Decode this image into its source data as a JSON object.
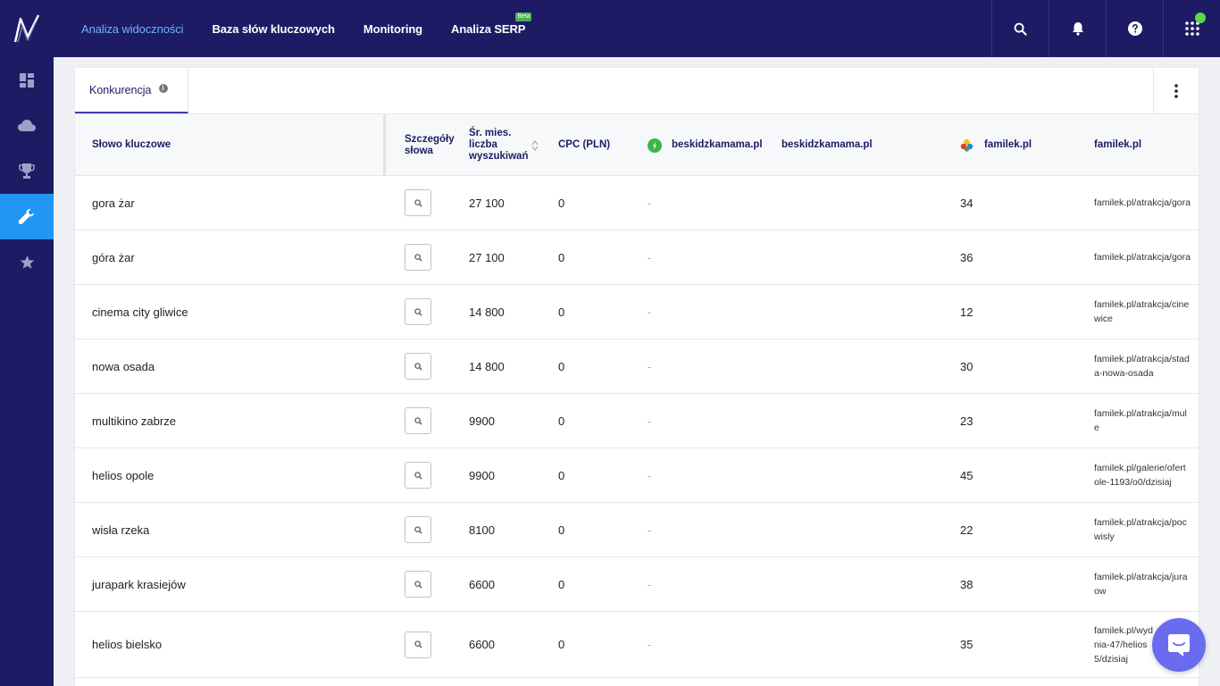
{
  "nav": {
    "items": [
      {
        "label": "Analiza widoczności",
        "active": true
      },
      {
        "label": "Baza słów kluczowych",
        "active": false
      },
      {
        "label": "Monitoring",
        "active": false
      },
      {
        "label": "Analiza SERP",
        "active": false
      }
    ],
    "beta_badge": "Beta"
  },
  "tabs": {
    "active_label": "Konkurencja",
    "info_glyph": "i"
  },
  "table": {
    "headers": {
      "keyword": "Słowo kluczowe",
      "details_1": "Szczegóły",
      "details_2": "słowa",
      "volume_1": "Śr. mies.",
      "volume_2": "liczba",
      "volume_3": "wyszukiwań",
      "cpc": "CPC (PLN)",
      "competitor_1_pos": "beskidzkamama.pl",
      "competitor_1_url": "beskidzkamama.pl",
      "competitor_2_pos": "familek.pl",
      "competitor_2_url": "familek.pl"
    },
    "rows": [
      {
        "keyword": "gora żar",
        "volume": "27 100",
        "cpc": "0",
        "beskidzkamama": "-",
        "familek_pos": "34",
        "familek_url_1": "familek.pl/atrakcja/gora",
        "familek_url_2": ""
      },
      {
        "keyword": "góra żar",
        "volume": "27 100",
        "cpc": "0",
        "beskidzkamama": "-",
        "familek_pos": "36",
        "familek_url_1": "familek.pl/atrakcja/gora",
        "familek_url_2": ""
      },
      {
        "keyword": "cinema city gliwice",
        "volume": "14 800",
        "cpc": "0",
        "beskidzkamama": "-",
        "familek_pos": "12",
        "familek_url_1": "familek.pl/atrakcja/cine",
        "familek_url_2": "wice"
      },
      {
        "keyword": "nowa osada",
        "volume": "14 800",
        "cpc": "0",
        "beskidzkamama": "-",
        "familek_pos": "30",
        "familek_url_1": "familek.pl/atrakcja/stad",
        "familek_url_2": "a-nowa-osada"
      },
      {
        "keyword": "multikino zabrze",
        "volume": "9900",
        "cpc": "0",
        "beskidzkamama": "-",
        "familek_pos": "23",
        "familek_url_1": "familek.pl/atrakcja/mul",
        "familek_url_2": "e"
      },
      {
        "keyword": "helios opole",
        "volume": "9900",
        "cpc": "0",
        "beskidzkamama": "-",
        "familek_pos": "45",
        "familek_url_1": "familek.pl/galerie/ofert",
        "familek_url_2": "ole-1193/o0/dzisiaj"
      },
      {
        "keyword": "wisła rzeka",
        "volume": "8100",
        "cpc": "0",
        "beskidzkamama": "-",
        "familek_pos": "22",
        "familek_url_1": "familek.pl/atrakcja/poc",
        "familek_url_2": "wisly"
      },
      {
        "keyword": "jurapark krasiejów",
        "volume": "6600",
        "cpc": "0",
        "beskidzkamama": "-",
        "familek_pos": "38",
        "familek_url_1": "familek.pl/atrakcja/jura",
        "familek_url_2": "ow"
      },
      {
        "keyword": "helios bielsko",
        "volume": "6600",
        "cpc": "0",
        "beskidzkamama": "-",
        "familek_pos": "35",
        "familek_url_1": "familek.pl/wyd",
        "familek_url_2": "nia-47/helios",
        "familek_url_3": "5/dzisiaj"
      }
    ]
  },
  "colors": {
    "topbar": "#1d1b64",
    "accent": "#2196f3",
    "active_nav": "#6fb3ff",
    "status_green": "#5cd64a",
    "chat": "#6a6cf0"
  },
  "icons": {
    "logo": "brand-logo-icon",
    "search": "search-icon",
    "bell": "bell-icon",
    "help": "help-icon",
    "apps": "apps-grid-icon",
    "sidebar": [
      "dashboard-icon",
      "cloud-icon",
      "trophy-icon",
      "wrench-icon",
      "star-icon"
    ]
  }
}
